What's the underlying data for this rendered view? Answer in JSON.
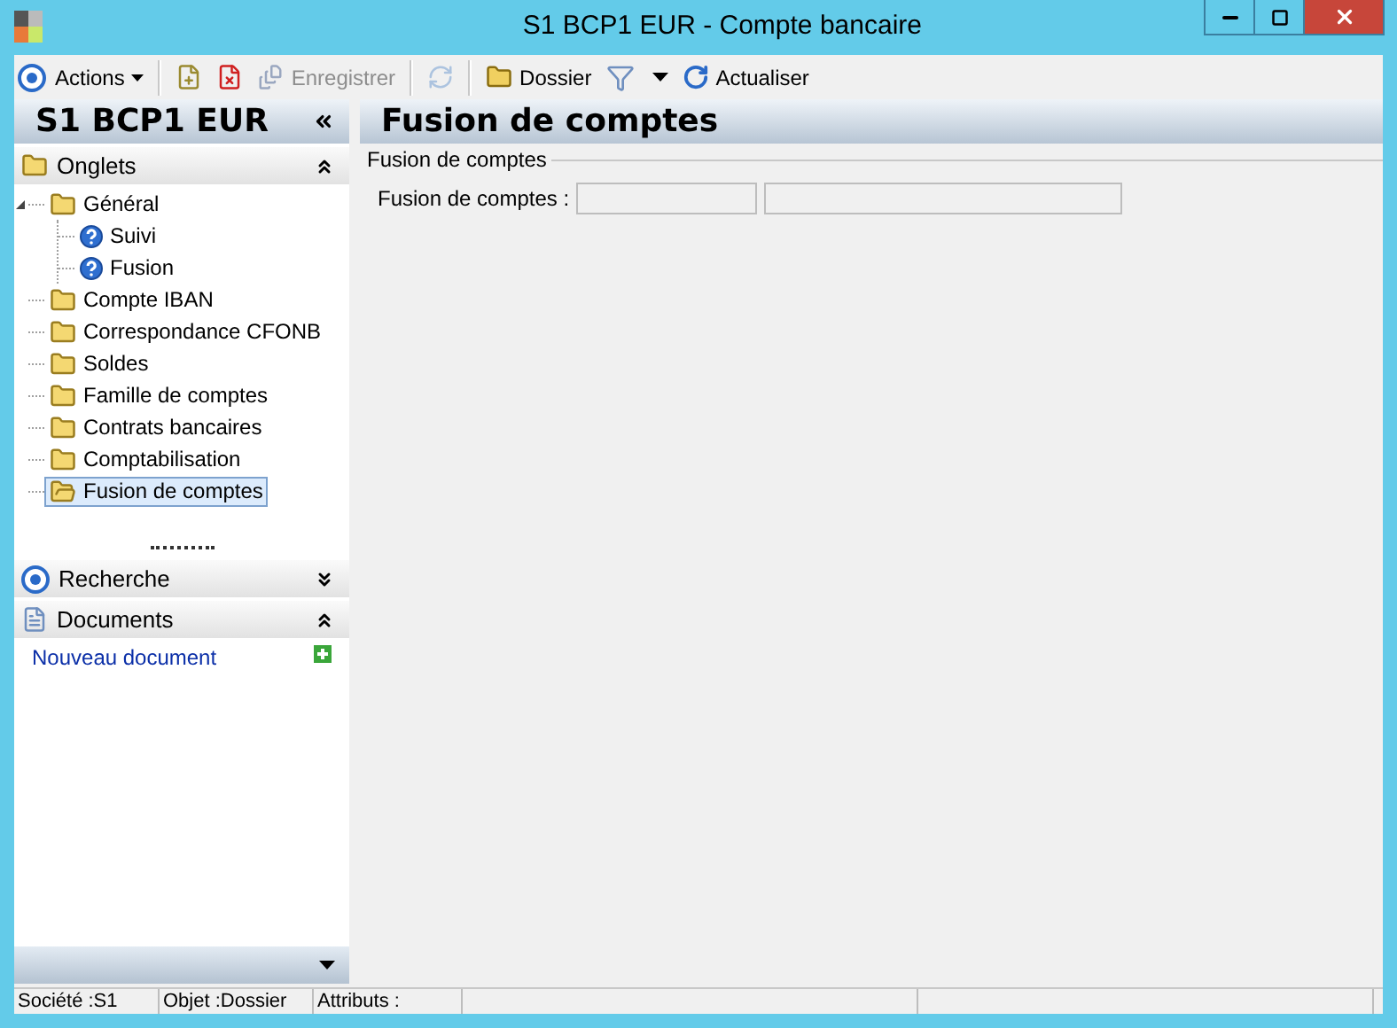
{
  "window": {
    "title": "S1 BCP1 EUR -  Compte bancaire"
  },
  "toolbar": {
    "groups": [
      [
        {
          "kind": "menu",
          "label": "Actions",
          "disabled": false
        }
      ],
      [
        {
          "kind": "icon",
          "disabled": false
        },
        {
          "kind": "icon",
          "disabled": false
        },
        {
          "kind": "button",
          "label": "Enregistrer",
          "disabled": true
        }
      ],
      [
        {
          "kind": "icon",
          "disabled": true
        }
      ],
      [
        {
          "kind": "button",
          "label": "Dossier",
          "disabled": false
        },
        {
          "kind": "dropdown",
          "disabled": false
        },
        {
          "kind": "button",
          "label": "Actualiser",
          "disabled": false
        }
      ]
    ]
  },
  "sidebar": {
    "title": "S1 BCP1 EUR",
    "tabs_section": {
      "title": "Onglets",
      "expanded": true,
      "tree": [
        {
          "label": "Général",
          "kind": "folder",
          "expanded": true,
          "selected": false,
          "children": [
            {
              "label": "Suivi",
              "kind": "help",
              "selected": false
            },
            {
              "label": "Fusion",
              "kind": "help",
              "selected": false
            }
          ]
        },
        {
          "label": "Compte IBAN",
          "kind": "folder",
          "selected": false
        },
        {
          "label": "Correspondance CFONB",
          "kind": "folder",
          "selected": false
        },
        {
          "label": "Soldes",
          "kind": "folder",
          "selected": false
        },
        {
          "label": "Famille de comptes",
          "kind": "folder",
          "selected": false
        },
        {
          "label": "Contrats bancaires",
          "kind": "folder",
          "selected": false
        },
        {
          "label": "Comptabilisation",
          "kind": "folder",
          "selected": false
        },
        {
          "label": "Fusion de comptes",
          "kind": "folder",
          "selected": true
        }
      ]
    },
    "search_section": {
      "title": "Recherche",
      "expanded": false
    },
    "documents_section": {
      "title": "Documents",
      "expanded": true,
      "link": "Nouveau document"
    }
  },
  "content": {
    "title": "Fusion de comptes",
    "group": {
      "legend": "Fusion de comptes",
      "field_label": "Fusion de comptes :",
      "fields_disabled": true
    }
  },
  "status_bar": [
    "Société :S1",
    "Objet :Dossier",
    "Attributs :"
  ]
}
